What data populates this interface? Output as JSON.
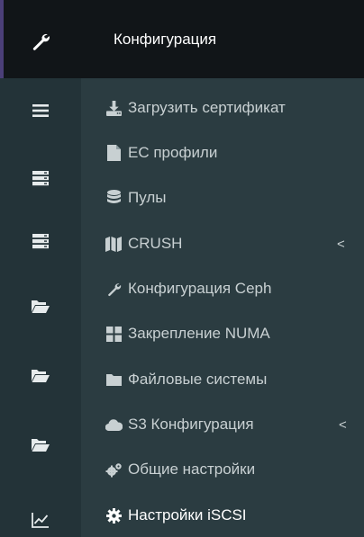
{
  "header": {
    "title": "Конфигурация"
  },
  "rail": {
    "items": [
      {
        "icon": "wrench-icon"
      },
      {
        "icon": "hamburger-menu-icon"
      },
      {
        "icon": "server-icon"
      },
      {
        "icon": "server-icon"
      },
      {
        "icon": "folder-open-icon"
      },
      {
        "icon": "folder-open-icon"
      },
      {
        "icon": "folder-open-icon"
      },
      {
        "icon": "line-chart-icon"
      }
    ]
  },
  "menu": {
    "items": [
      {
        "label": "Загрузить сертификат",
        "icon": "upload-icon"
      },
      {
        "label": "EC профили",
        "icon": "file-icon"
      },
      {
        "label": "Пулы",
        "icon": "database-icon"
      },
      {
        "label": "CRUSH",
        "icon": "map-icon",
        "chevron": "<"
      },
      {
        "label": "Конфигурация Ceph",
        "icon": "wrench-icon"
      },
      {
        "label": "Закрепление NUMA",
        "icon": "grid-icon"
      },
      {
        "label": "Файловые системы",
        "icon": "folder-icon"
      },
      {
        "label": "S3 Конфигурация",
        "icon": "cloud-icon",
        "chevron": "<"
      },
      {
        "label": "Общие настройки",
        "icon": "cogs-icon"
      },
      {
        "label": "Настройки iSCSI",
        "icon": "cog-icon",
        "active": true
      }
    ]
  },
  "colors": {
    "rail_bg": "#233338",
    "panel_bg": "#2b3c41",
    "header_bg": "#111518",
    "text": "#c8d0d2",
    "active_text": "#ffffff",
    "accent": "#4b3f78"
  }
}
